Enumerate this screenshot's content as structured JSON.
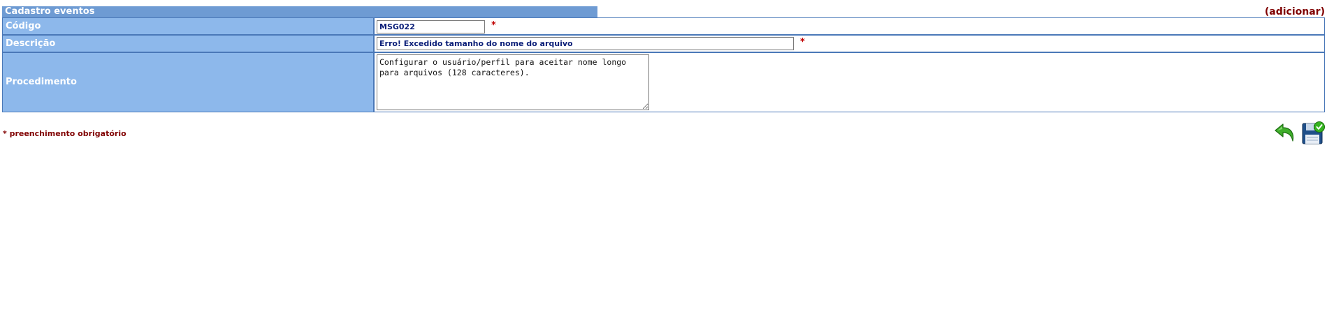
{
  "header": {
    "title": "Cadastro eventos",
    "add_link": "(adicionar)"
  },
  "form": {
    "codigo": {
      "label": "Código",
      "value": "MSG022",
      "required_mark": "*"
    },
    "descricao": {
      "label": "Descrição",
      "value": "Erro! Excedido tamanho do nome do arquivo",
      "required_mark": "*"
    },
    "procedimento": {
      "label": "Procedimento",
      "value": "Configurar o usuário/perfil para aceitar nome longo para arquivos (128 caracteres)."
    }
  },
  "footer": {
    "mandatory_note": "* preenchimento obrigatório"
  },
  "actions": {
    "back_icon": "back-arrow-icon",
    "save_icon": "save-disk-check-icon"
  },
  "colors": {
    "header_bg": "#6e9bd3",
    "label_bg": "#8db8eb",
    "border": "#4a78b8",
    "accent_text": "#800000",
    "required_star": "#c00000",
    "input_text": "#0a1e78"
  }
}
